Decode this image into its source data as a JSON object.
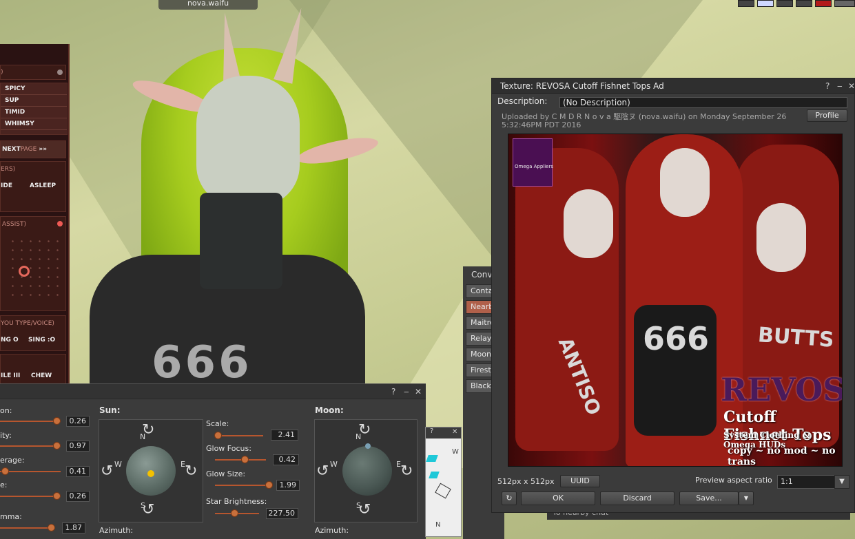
{
  "nametag": "nova.waifu",
  "hud": {
    "list": [
      "SPICY",
      "SUP",
      "TIMID",
      "WHIMSY"
    ],
    "nextpage": "NEXT",
    "nextpage_suffix": "PAGE",
    "sec_others": "ERS)",
    "hide": "IDE",
    "asleep": "ASLEEP",
    "assist": "ASSIST)",
    "you_type": "YOU TYPE/VOICE)",
    "sing_o": "NG O",
    "sing_colon_o": "SING :O",
    "ile_iii": "ILE III",
    "chew": "CHEW"
  },
  "avatar": {
    "shirt_text": "666"
  },
  "windlight": {
    "left_labels": [
      "on:",
      "ity:",
      "erage:",
      "e:",
      "mma:"
    ],
    "left_values": [
      "0.26",
      "0.97",
      "0.41",
      "0.26",
      "1.87"
    ],
    "left_levels": [
      1.0,
      1.0,
      0.08,
      1.0,
      1.0
    ],
    "sun_title": "Sun:",
    "moon_title": "Moon:",
    "scale_label": "Scale:",
    "scale_value": "2.41",
    "glow_focus_label": "Glow Focus:",
    "glow_focus_value": "0.42",
    "glow_size_label": "Glow Size:",
    "glow_size_value": "1.99",
    "star_label": "Star Brightness:",
    "star_value": "227.50",
    "azimuth_label": "Azimuth:",
    "compass": {
      "n": "N",
      "s": "S",
      "e": "E",
      "w": "W"
    },
    "help": "?",
    "minimize": "‒",
    "close": "✕"
  },
  "minimap": {
    "help": "?",
    "close": "✕",
    "w": "W",
    "n": "N"
  },
  "conversations": {
    "title": "Conv",
    "tabs": [
      "Conta",
      "Nearb",
      "Maitre",
      "Relay",
      "Moons",
      "Firesto",
      "Black I"
    ],
    "selected_index": 1
  },
  "chat_placeholder": "To nearby chat",
  "texture": {
    "title": "Texture: REVOSA Cutoff Fishnet Tops Ad",
    "help": "?",
    "minimize": "‒",
    "close": "✕",
    "description_label": "Description:",
    "description_value": "(No Description)",
    "uploaded_line1": "Uploaded by C M D R  N o v a  駆陰ヌ (nova.waifu) on Monday September 26",
    "uploaded_line2": "5:32:46PM PDT 2016",
    "profile_button": "Profile",
    "image": {
      "logo_text": "Omega Appliers",
      "n666": "666",
      "butts": "BUTTS",
      "antis": "ANTISO",
      "brand": "REVOSA",
      "line1": "Cutoff Fishnet Tops",
      "line2": "System Clothing & Omega HUDs",
      "line3": "copy ~ no mod ~ no trans"
    },
    "size_text": "512px x 512px",
    "uuid_button": "UUID",
    "aspect_label": "Preview aspect ratio",
    "aspect_value": "1:1",
    "ok_button": "OK",
    "discard_button": "Discard",
    "save_button": "Save...",
    "refresh_icon": "↻",
    "dropdown_arrow": "▼"
  }
}
